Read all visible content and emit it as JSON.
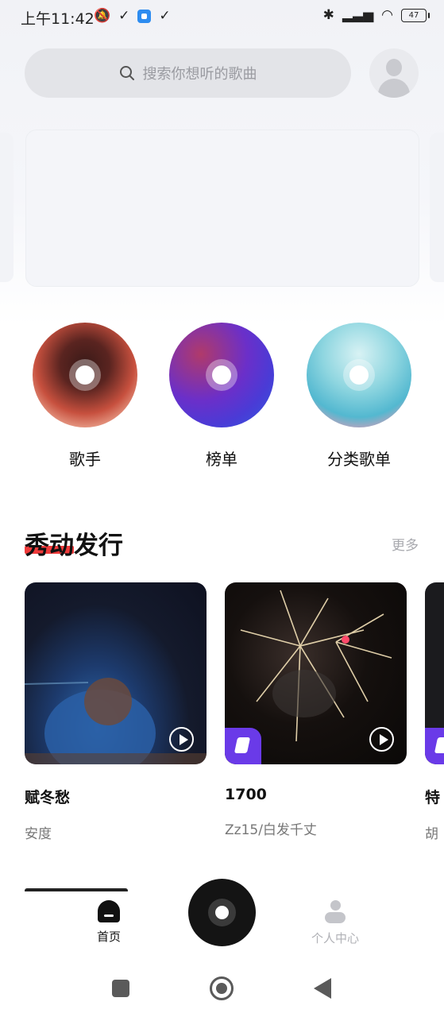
{
  "status_bar": {
    "time": "上午11:42",
    "battery": "47"
  },
  "search": {
    "placeholder": "搜索你想听的歌曲"
  },
  "categories": [
    {
      "label": "歌手",
      "icon": "singer-disc"
    },
    {
      "label": "榜单",
      "icon": "chart-disc"
    },
    {
      "label": "分类歌单",
      "icon": "category-disc"
    }
  ],
  "section": {
    "title": "秀动发行",
    "more": "更多"
  },
  "releases": [
    {
      "title": "赋冬愁",
      "artist": "安度"
    },
    {
      "title": "1700",
      "artist": "Zz15/白发千丈"
    },
    {
      "title": "特",
      "artist": "胡"
    }
  ],
  "tabs": {
    "home": "首页",
    "me": "个人中心"
  },
  "colors": {
    "accent_red": "#ef3b3b",
    "badge_purple": "#6a3ae8"
  }
}
